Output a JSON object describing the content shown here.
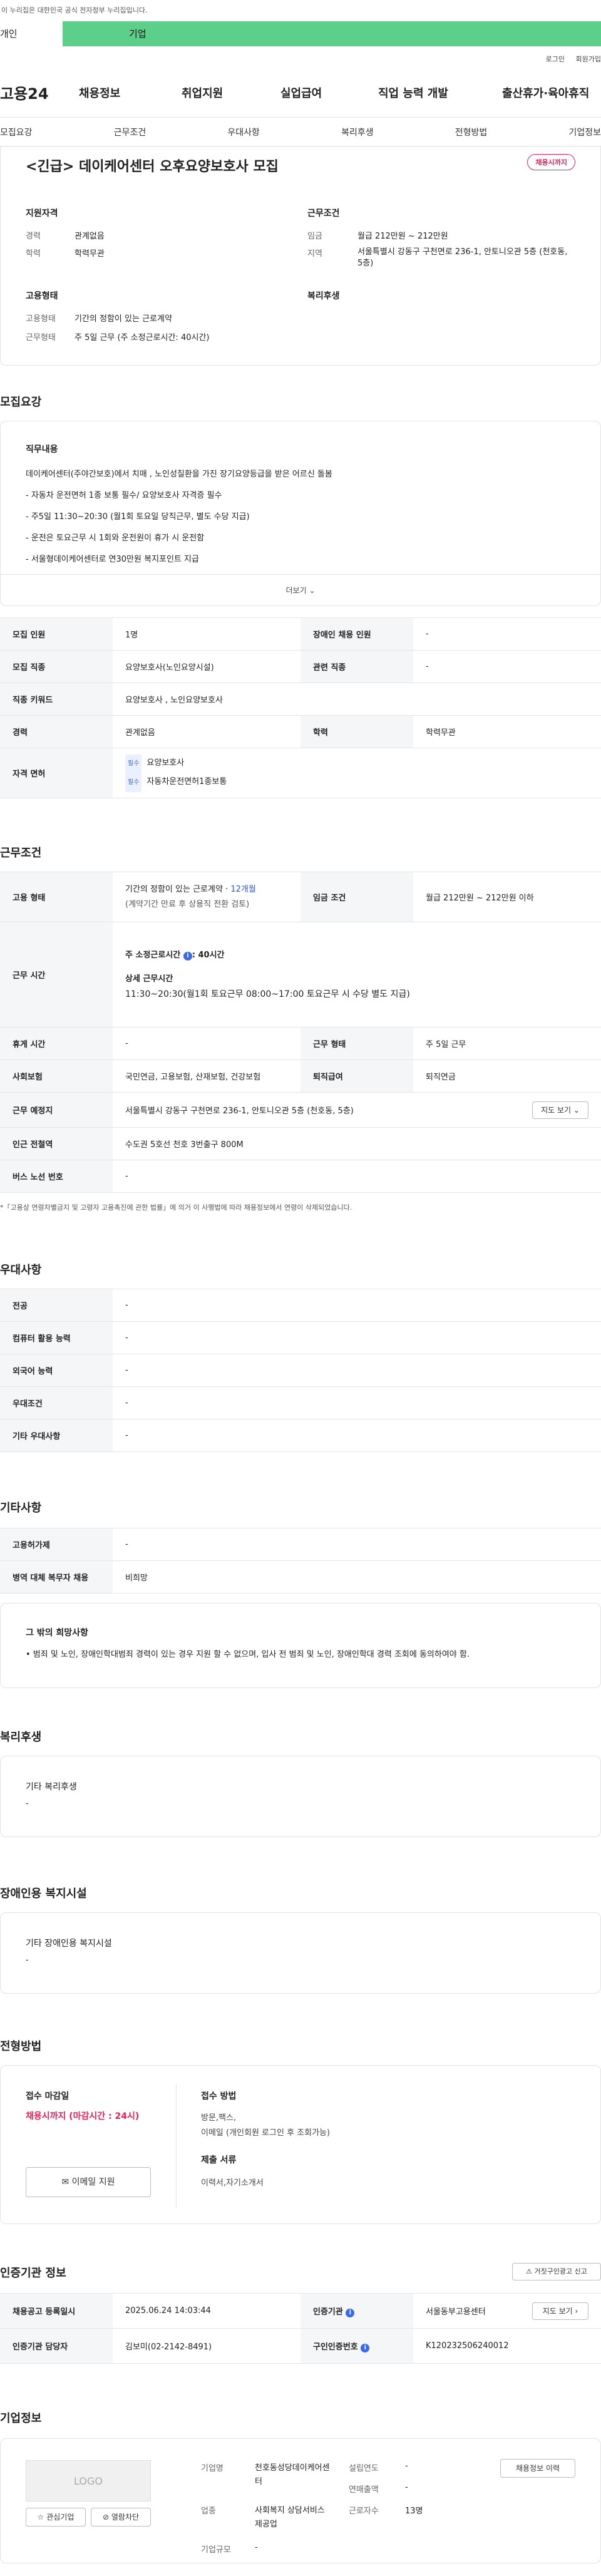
{
  "gov_banner": "이 누리집은 대한민국 공식 전자정부 누리집입니다.",
  "tabs": {
    "individual": "개인",
    "company": "기업"
  },
  "util": {
    "login": "로그인",
    "signup": "회원가입"
  },
  "logo": "고용24",
  "gnb": [
    "채용정보",
    "취업지원",
    "실업급여",
    "직업 능력 개발",
    "출산휴가·육아휴직"
  ],
  "subnav": [
    "모집요강",
    "근무조건",
    "우대사항",
    "복리후생",
    "전형방법",
    "기업정보"
  ],
  "job": {
    "title": "<긴급> 데이케어센터 오후요양보호사 모집",
    "status_badge": "채용시까지",
    "summary": {
      "qual_head": "지원자격",
      "career_label": "경력",
      "career_value": "관계없음",
      "edu_label": "학력",
      "edu_value": "학력무관",
      "cond_head": "근무조건",
      "wage_label": "임금",
      "wage_value": "월급 212만원 ~ 212만원",
      "area_label": "지역",
      "area_value": "서울특별시 강동구 구천면로 236-1, 안토니오관 5층 (천호동, 5층)",
      "emp_head": "고용형태",
      "emp_type_label": "고용형태",
      "emp_type_value": "기간의 정함이 있는 근로계약",
      "work_type_label": "근무형태",
      "work_type_value": "주 5일 근무 (주 소정근로시간: 40시간)",
      "welfare_head": "복리후생"
    }
  },
  "recruit": {
    "title": "모집요강",
    "duty_head": "직무내용",
    "duty_lines": [
      "데이케어센터(주야간보호)에서 치매 , 노인성질환을 가진 장기요양등급을 받은 어르신 돌봄",
      "- 자동차 운전면허 1종 보통 필수/ 요양보호사 자격증 필수",
      "- 주5일 11:30~20:30  (월1회 토요일 당직근무, 별도 수당 지급)",
      "- 운전은 토요근무 시 1회와 운전원이 휴가 시 운전함",
      "- 서울형데이케어센터로 연30만원 복지포인트 지급"
    ],
    "more": "더보기",
    "rows": {
      "headcount_label": "모집 인원",
      "headcount_value": "1명",
      "disabled_label": "장애인 채용 인원",
      "disabled_value": "-",
      "job_label": "모집 직종",
      "job_value": "요양보호사(노인요양시설)",
      "related_label": "관련 직종",
      "related_value": "-",
      "keyword_label": "직종 키워드",
      "keyword_value": "요양보호사 , 노인요양보호사",
      "career_label": "경력",
      "career_value": "관계없음",
      "edu_label": "학력",
      "edu_value": "학력무관",
      "license_label": "자격 면허",
      "licenses": [
        {
          "tag": "필수",
          "name": "요양보호사"
        },
        {
          "tag": "필수",
          "name": "자동차운전면허1종보통"
        }
      ]
    }
  },
  "conditions": {
    "title": "근무조건",
    "emp_label": "고용 형태",
    "emp_value_prefix": "기간의 정함이 있는 근로계약 · ",
    "emp_value_months": "12개월",
    "emp_value_note": "(계약기간 만료 후 상용직 전환 검토)",
    "wage_label": "임금 조건",
    "wage_value": "월급 212만원 ~ 212만원 이하",
    "hours_label": "근무 시간",
    "hours_weekly_prefix": "주 소정근로시간",
    "hours_weekly_suffix": ": 40시간",
    "hours_detail_head": "상세 근무시간",
    "hours_detail": "11:30~20:30(월1회 토요근무 08:00~17:00 토요근무 시 수당 별도 지급)",
    "rest_label": "휴게 시간",
    "rest_value": "-",
    "form_label": "근무 형태",
    "form_value": "주 5일 근무",
    "insurance_label": "사회보험",
    "insurance_value": "국민연금, 고용보험, 산재보험, 건강보험",
    "severance_label": "퇴직급여",
    "severance_value": "퇴직연금",
    "place_label": "근무 예정지",
    "place_value": "서울특별시 강동구 구천면로 236-1, 안토니오관 5층 (천호동, 5층)",
    "map_btn": "지도 보기",
    "subway_label": "인근 전철역",
    "subway_value": "수도권 5호선 천호 3번출구 800M",
    "bus_label": "버스 노선 번호",
    "bus_value": "-",
    "footnote": "*「고용상 연령차별금지 및 고령자 고용촉진에 관한 법률」에 의거 이 사행법에 따라 채용정보에서 연령이 삭제되었습니다."
  },
  "preference": {
    "title": "우대사항",
    "rows": [
      {
        "label": "전공",
        "value": "-"
      },
      {
        "label": "컴퓨터 활용 능력",
        "value": "-"
      },
      {
        "label": "외국어 능력",
        "value": "-"
      },
      {
        "label": "우대조건",
        "value": "-"
      },
      {
        "label": "기타 우대사항",
        "value": "-"
      }
    ]
  },
  "other": {
    "title": "기타사항",
    "rows": [
      {
        "label": "고용허가제",
        "value": "-"
      },
      {
        "label": "병역 대체 복무자 채용",
        "value": "비희망"
      }
    ],
    "wish_head": "그 밖의 희망사항",
    "wish_text": "• 범죄 및 노인, 장애인학대범죄 경력이 있는 경우 지원 할 수 없으며, 입사 전 범죄 및 노인, 장애인학대 경력 조회에 동의하여야 함."
  },
  "welfare": {
    "title": "복리후생",
    "head": "기타 복리후생",
    "value": "-"
  },
  "disability": {
    "title": "장애인용 복지시설",
    "head": "기타 장애인용 복지시설",
    "value": "-"
  },
  "process": {
    "title": "전형방법",
    "deadline_head": "접수 마감일",
    "deadline_value": "채용시까지 (마감시간 : 24시)",
    "email_btn": "이메일 지원",
    "method_head": "접수 방법",
    "method_value": "방문,팩스,",
    "method_note": "이메일 (개인회원 로그인 후 조회가능)",
    "docs_head": "제출 서류",
    "docs_value": "이력서,자기소개서"
  },
  "cert": {
    "title": "인증기관 정보",
    "report_btn": "거짓구인광고 신고",
    "reg_label": "채용공고 등록일시",
    "reg_value": "2025.06.24 14:03:44",
    "agency_label": "인증기관",
    "agency_value": "서울동부고용센터",
    "agency_btn": "지도 보기",
    "manager_label": "인증기관 담당자",
    "manager_value": "김보미(02-2142-8491)",
    "job_no_label": "구인인증번호",
    "job_no_value": "K120232506240012"
  },
  "company": {
    "title": "기업정보",
    "logo_text": "LOGO",
    "fav_btn": "관심기업",
    "block_btn": "열람차단",
    "name_label": "기업명",
    "name_value": "천호동성당데이케어센터",
    "industry_label": "업종",
    "industry_value": "사회복지 상담서비스 제공업",
    "size_label": "기업규모",
    "size_value": "-",
    "founded_label": "설립연도",
    "founded_value": "-",
    "revenue_label": "연매출액",
    "revenue_value": "-",
    "employees_label": "근로자수",
    "employees_value": "13명",
    "jobs_btn": "채용정보 이력"
  }
}
